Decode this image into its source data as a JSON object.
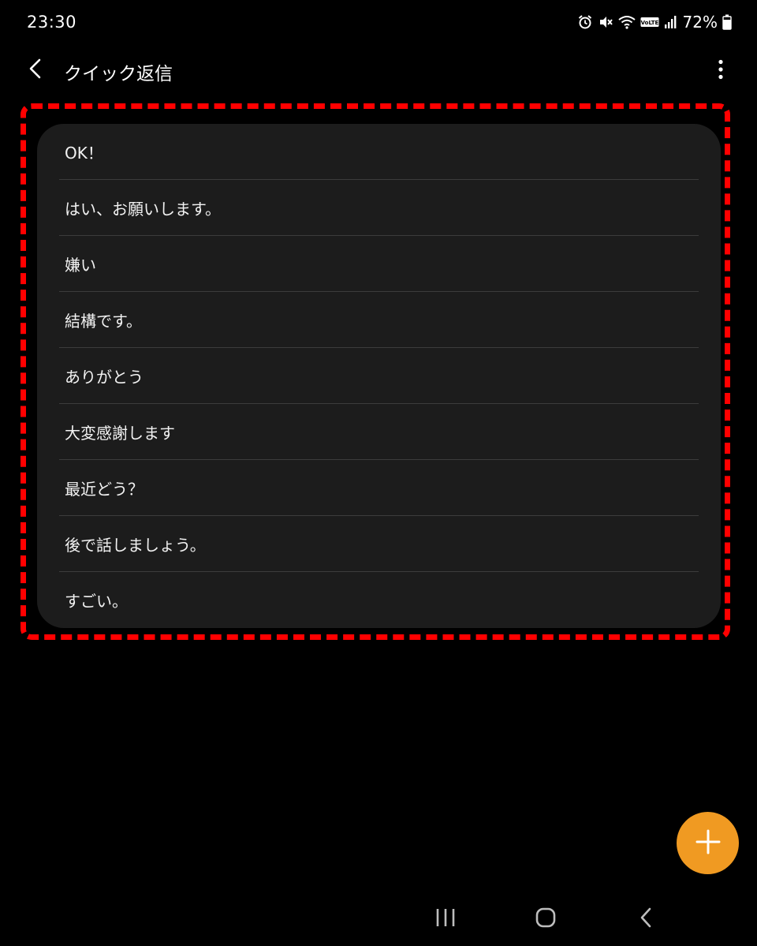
{
  "status_bar": {
    "time": "23:30",
    "battery": "72%",
    "volte_label": "VoLTE",
    "icons": [
      "alarm-icon",
      "mute-icon",
      "wifi-icon",
      "volte-icon",
      "signal-icon",
      "battery-icon"
    ]
  },
  "header": {
    "title": "クイック返信",
    "back_icon": "chevron-left-icon",
    "more_icon": "more-vertical-icon"
  },
  "replies": [
    "OK！",
    "はい、お願いします。",
    "嫌い",
    "結構です。",
    "ありがとう",
    "大変感謝します",
    "最近どう？",
    "後で話しましょう。",
    "すごい。"
  ],
  "fab": {
    "icon": "plus-icon"
  },
  "nav_bar": {
    "icons": [
      "recents-icon",
      "home-icon",
      "back-icon"
    ]
  },
  "colors": {
    "background": "#000000",
    "card": "#1c1c1c",
    "divider": "#3c3c3c",
    "highlight": "#ff0000",
    "fab": "#f09a22"
  }
}
